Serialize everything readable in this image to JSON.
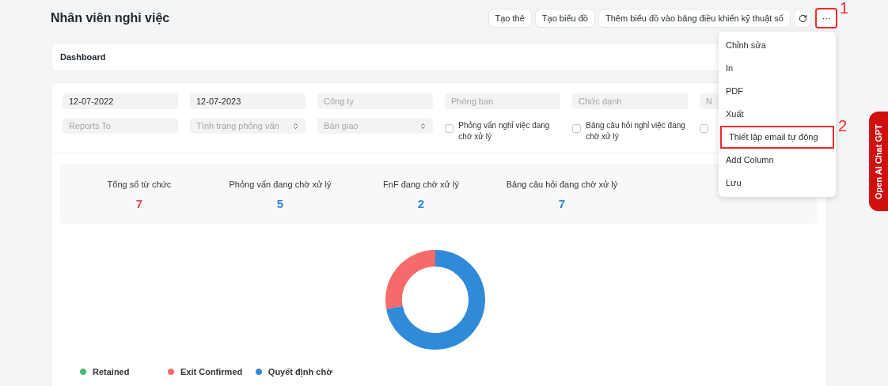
{
  "page": {
    "title": "Nhân viên nghỉ việc"
  },
  "toolbar": {
    "buttons": [
      {
        "label": "Tạo thẻ",
        "kind": "text"
      },
      {
        "label": "Tạo biểu đồ",
        "kind": "text"
      },
      {
        "label": "Thêm biểu đồ vào bảng điều khiển kỹ thuật số",
        "kind": "text"
      },
      {
        "kind": "refresh"
      },
      {
        "label": "···",
        "kind": "more",
        "highlighted": true,
        "annotation": "1"
      }
    ]
  },
  "menu": {
    "items": [
      {
        "label": "Chỉnh sửa",
        "highlighted": false
      },
      {
        "label": "In",
        "highlighted": false
      },
      {
        "label": "PDF",
        "highlighted": false
      },
      {
        "label": "Xuất",
        "highlighted": false
      },
      {
        "label": "Thiết lập email tự động",
        "highlighted": true,
        "annotation": "2"
      },
      {
        "label": "Add Column",
        "highlighted": false
      },
      {
        "label": "Lưu",
        "highlighted": false
      }
    ]
  },
  "dashboard_bar": {
    "label": "Dashboard"
  },
  "filters": {
    "row_1": [
      {
        "kind": "input",
        "value": "12-07-2022"
      },
      {
        "kind": "input",
        "value": "12-07-2023"
      },
      {
        "kind": "input",
        "placeholder": "Công ty"
      },
      {
        "kind": "input",
        "placeholder": "Phòng ban"
      },
      {
        "kind": "input",
        "placeholder": "Chức danh"
      },
      {
        "kind": "input",
        "placeholder": "N"
      }
    ],
    "row_2": [
      {
        "kind": "input",
        "placeholder": "Reports To"
      },
      {
        "kind": "select",
        "placeholder": "Tình trạng phỏng vấn"
      },
      {
        "kind": "select",
        "placeholder": "Bàn giao"
      },
      {
        "kind": "checkbox",
        "label": "Phỏng vấn nghỉ việc đang chờ xử lý",
        "checked": false
      },
      {
        "kind": "checkbox",
        "label": "Bảng câu hỏi nghỉ việc đang chờ xử lý",
        "checked": false
      },
      {
        "kind": "checkbox",
        "checked": false
      }
    ]
  },
  "stats": [
    {
      "label": "Tổng số từ chức",
      "value": "7",
      "color": "#e24c4c"
    },
    {
      "label": "Phỏng vấn đang chờ xử lý",
      "value": "5",
      "color": "#2f86eb"
    },
    {
      "label": "FnF đang chờ xử lý",
      "value": "2",
      "color": "#2f86eb"
    },
    {
      "label": "Bảng câu hỏi đang chờ xử lý",
      "value": "7",
      "color": "#2f86eb"
    }
  ],
  "legend": [
    {
      "label": "Retained",
      "color": "#48bb74"
    },
    {
      "label": "Exit Confirmed",
      "color": "#f56b6b"
    },
    {
      "label": "Quyết định chờ",
      "color": "#318ad8"
    }
  ],
  "side_tab": {
    "label": "Open AI Chat GPT"
  }
}
